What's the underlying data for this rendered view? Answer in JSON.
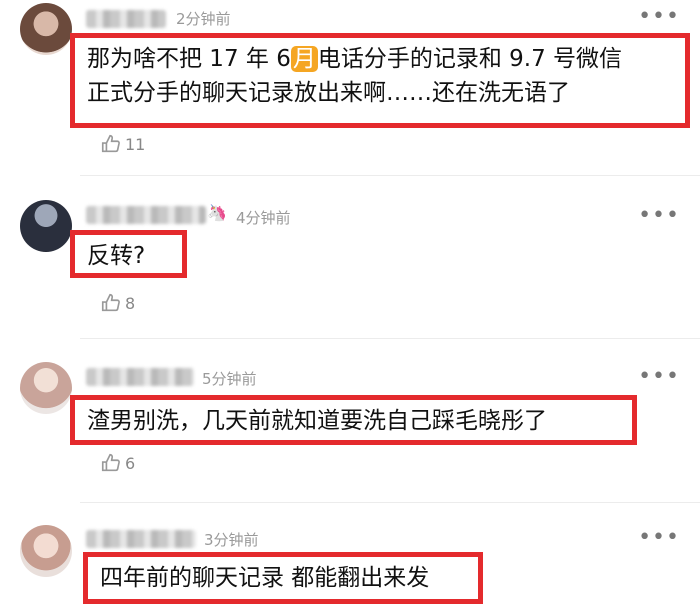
{
  "comments": [
    {
      "time": "2分钟前",
      "text_pre": "那为啥不把 17 年 6",
      "text_hl": "月",
      "text_post": "电话分手的记录和 9.7 号微信",
      "text_line2": "正式分手的聊天记录放出来啊……还在洗无语了",
      "likes": "11"
    },
    {
      "time": "4分钟前",
      "text": "反转?",
      "likes": "8"
    },
    {
      "time": "5分钟前",
      "text": "渣男别洗，几天前就知道要洗自己踩毛晓彤了",
      "likes": "6"
    },
    {
      "time": "3分钟前",
      "text": "四年前的聊天记录 都能翻出来发",
      "likes": ""
    }
  ],
  "icons": {
    "more": "more-dots-icon",
    "like": "thumbs-up-icon"
  },
  "colors": {
    "highlight_border": "#e42a2d",
    "month_badge": "#f5a623"
  }
}
